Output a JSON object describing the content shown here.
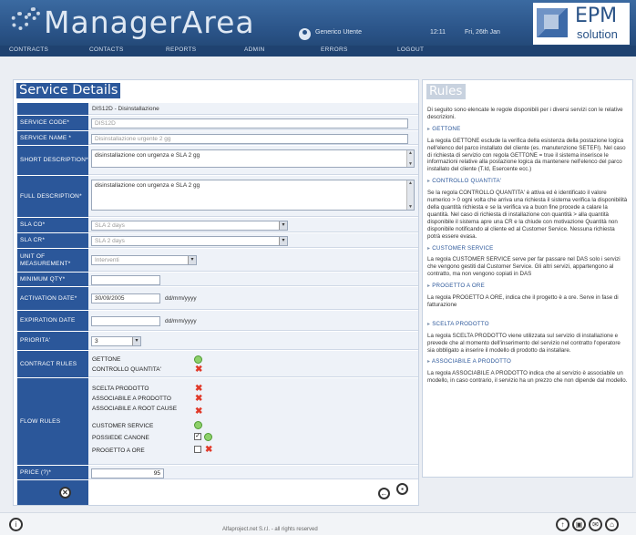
{
  "header": {
    "app_title": "ManagerArea",
    "user_name": "Generico Utente",
    "time": "12:11",
    "date": "Fri, 26th Jan",
    "brand_name": "EPM",
    "brand_sub": "solution"
  },
  "nav": {
    "items": [
      "CONTRACTS",
      "CONTACTS",
      "REPORTS",
      "ADMIN",
      "ERRORS",
      "LOGOUT"
    ]
  },
  "service": {
    "title": "Service Details",
    "caption": "DIS12D - Disinstallazione",
    "fields": {
      "code": {
        "label": "SERVICE CODE*",
        "value": "DIS12D"
      },
      "name": {
        "label": "SERVICE NAME *",
        "value": "Disinstallazione urgente 2 gg"
      },
      "short_desc": {
        "label": "SHORT DESCRIPTION*",
        "value": "disinstallazione con urgenza e SLA 2 gg"
      },
      "full_desc": {
        "label": "FULL DESCRIPTION*",
        "value": "disinstallazione con urgenza e SLA 2 gg"
      },
      "sla_co": {
        "label": "SLA CO*",
        "value": "SLA 2 days"
      },
      "sla_cr": {
        "label": "SLA CR*",
        "value": "SLA 2 days"
      },
      "unit": {
        "label": "UNIT OF MEASUREMENT*",
        "value": "Interventi"
      },
      "min_qty": {
        "label": "MINIMUM QTY*",
        "value": ""
      },
      "activation": {
        "label": "ACTIVATION DATE*",
        "value": "30/09/2005",
        "format": "dd/mm/yyyy"
      },
      "expiration": {
        "label": "EXPIRATION DATE",
        "value": "",
        "format": "dd/mm/yyyy"
      },
      "priority": {
        "label": "PRIORITA'",
        "value": "3"
      },
      "contract_rules": {
        "label": "CONTRACT RULES",
        "items": [
          {
            "name": "GETTONE",
            "status": "ok"
          },
          {
            "name": "CONTROLLO QUANTITA'",
            "status": "no"
          }
        ]
      },
      "flow_rules": {
        "label": "FLOW RULES",
        "items": [
          {
            "name": "SCELTA PRODOTTO",
            "status": "no"
          },
          {
            "name": "ASSOCIABILE A PRODOTTO",
            "status": "no"
          },
          {
            "name": "ASSOCIABILE A ROOT CAUSE",
            "status": "no"
          },
          {
            "name": "CUSTOMER SERVICE",
            "status": "ok"
          },
          {
            "name": "POSSIEDE CANONE",
            "status": "ok",
            "checked": true
          },
          {
            "name": "PROGETTO A ORE",
            "status": "no",
            "checked": false
          }
        ]
      },
      "price": {
        "label": "PRICE (?)*",
        "value": "95"
      }
    }
  },
  "rules": {
    "title": "Rules",
    "intro": "Di seguito sono elencate le regole disponibili per i diversi servizi con le relative descrizioni.",
    "sections": [
      {
        "heading": "GETTONE",
        "text": "La regola GETTONE esclude la verifica della esistenza della postazione logica nell'elenco del parco installato del cliente (es. manutenzione SETEFI). Nel caso di richiesta di servizio con regola GETTONE = true il sistema inserisce le informazioni relative alla postazione logica da mantenere nell'elenco del parco installato del cliente (T.Id, Esercente ecc.)"
      },
      {
        "heading": "CONTROLLO QUANTITA'",
        "text": "Se la regola CONTROLLO QUANTITA' è attiva ed è identificato il valore numerico > 0 ogni volta che arriva una richiesta il sistema verifica la disponibilità della quantità richiesta e se la verifica va a buon fine procede a calare la quantità. Nel caso di richiesta di installazione con quantità > alla quantità disponibile il sistema apre una CR e la chiude con motivazione Quantità non disponibile notificando al cliente ed al Customer Service. Nessuna richiesta potrà essere evasa."
      },
      {
        "heading": "CUSTOMER SERVICE",
        "text": "La regola CUSTOMER SERVICE serve per far passare nel DAS solo i servizi che vengono gestiti dal Customer Service. Gli altri servizi, appartengono al contratto, ma non vengono copiati in DAS"
      },
      {
        "heading": "PROGETTO A ORE",
        "text": "La regola PROGETTO A ORE, indica che il progetto è a ore. Serve in fase di fatturazione"
      },
      {
        "heading": "SCELTA PRODOTTO",
        "text": "La regola SCELTA PRODOTTO viene utilizzata sul servizio di installazione e prevede che al momento dell'inserimento del servizio nel contratto l'operatore sia obbligato a inserire il modello di prodotto da installare."
      },
      {
        "heading": "ASSOCIABILE A PRODOTTO",
        "text": "La regola ASSOCIABILE A PRODOTTO indica che al servizio è associabile un modello, in caso contrario, il servizio ha un prezzo che non dipende dal modello."
      }
    ]
  },
  "footer": {
    "copyright": "Alfaproject.net S.r.l. - all rights reserved"
  }
}
